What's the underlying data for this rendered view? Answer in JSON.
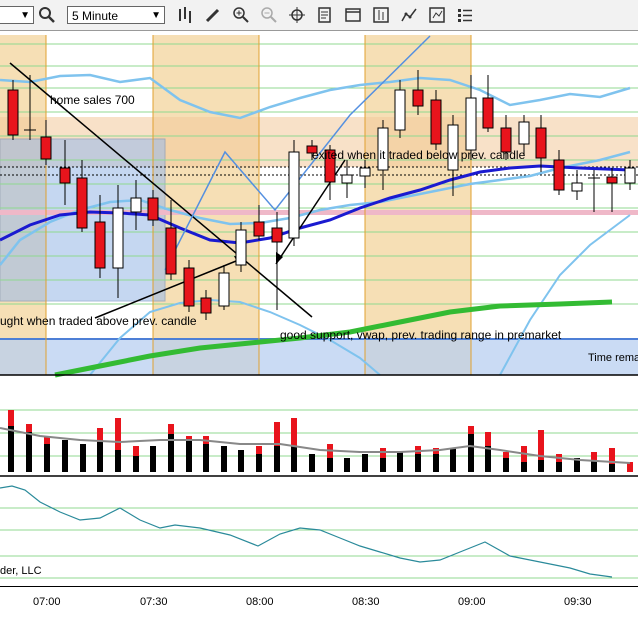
{
  "toolbar": {
    "symbol_value": "",
    "interval_value": "5 Minute",
    "icons": [
      "search-icon",
      "bar-chart-icon",
      "pencil-icon",
      "zoom-in-icon",
      "zoom-out-icon",
      "crosshair-icon",
      "document-icon",
      "window-icon",
      "grid-icon",
      "indicator-icon",
      "settings-icon",
      "list-icon"
    ]
  },
  "annotations": {
    "home_sales": "home sales 700",
    "exited": "exited when it traded below prev. candle",
    "bought": "ught when traded above prev. candle",
    "support": "good support, vwap, prev. trading range in premarket",
    "time_remaining": "Time rema",
    "copyright": "der, LLC"
  },
  "time_axis": [
    "07:00",
    "07:30",
    "08:00",
    "08:30",
    "09:00",
    "09:30"
  ],
  "colors": {
    "up_candle": "#ffffff",
    "down_candle": "#e8141c",
    "vwap": "#1a1ad0",
    "bollinger": "#7fc3ee",
    "green_ma": "#33bb33",
    "grid_green": "#90d890",
    "shade_orange": "#f6dfb5",
    "shade_blue": "#b8cff0"
  }
}
